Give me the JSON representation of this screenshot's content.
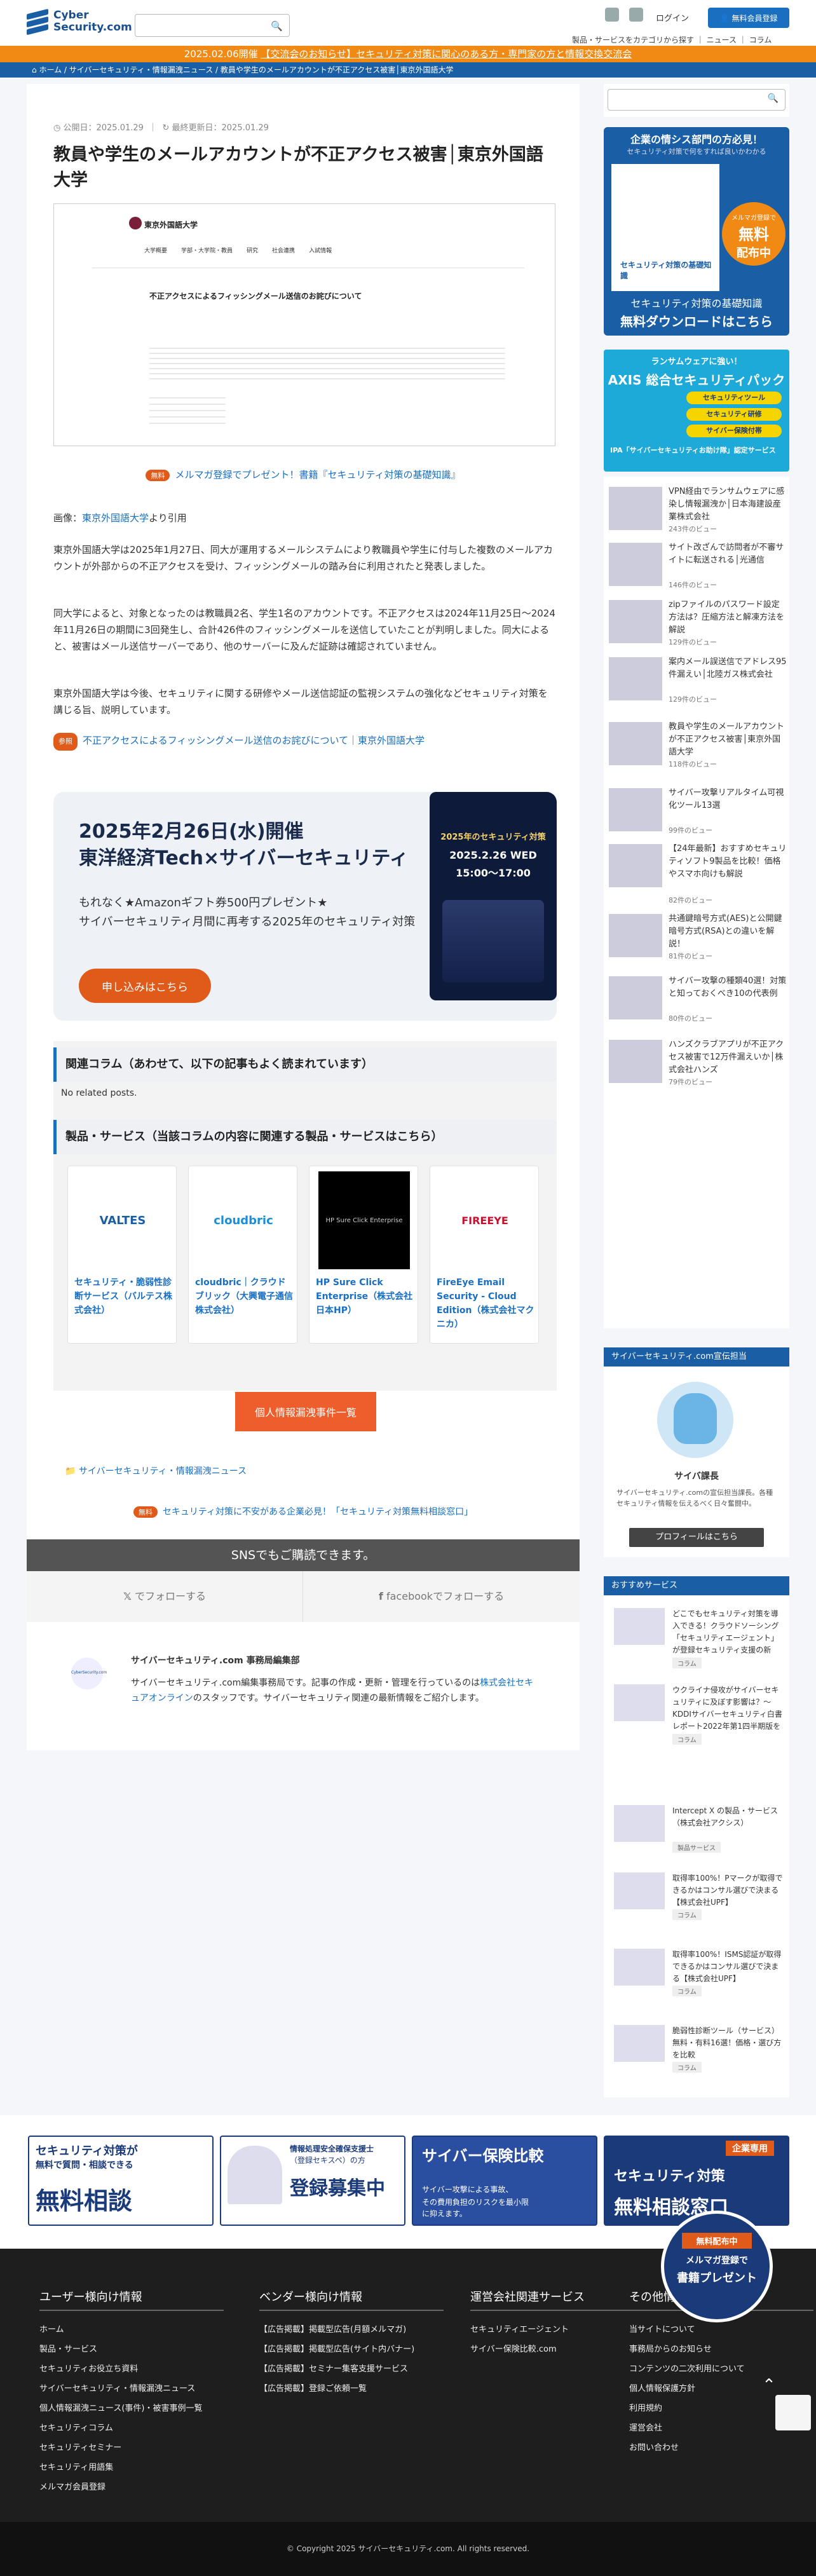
{
  "header": {
    "logo_line1": "Cyber",
    "logo_line2": "Security.com",
    "search_placeholder": "",
    "login": "ログイン",
    "register": "無料会員登録",
    "nav": [
      "製品・サービスをカテゴリから探す",
      "ニュース",
      "コラム"
    ]
  },
  "announcement": {
    "prefix": "2025.02.06開催",
    "link": "【交流会のお知らせ】セキュリティ対策に関心のある方・専門家の方と情報交換交流会"
  },
  "breadcrumb": [
    "ホーム",
    "サイバーセキュリティ・情報漏洩ニュース",
    "教員や学生のメールアカウントが不正アクセス被害│東京外国語大学"
  ],
  "article": {
    "published": "公開日：2025.01.29",
    "updated": "最終更新日：2025.01.29",
    "title": "教員や学生のメールアカウントが不正アクセス被害│東京外国語大学",
    "screenshot": {
      "univ": "東京外国語大学",
      "heading": "不正アクセスによるフィッシングメール送信のお詫びについて",
      "nav": [
        "大学概要",
        "学部・大学院・教員",
        "研究",
        "社会連携",
        "入試情報"
      ]
    },
    "promo_badge": "無料",
    "promo_text": "メルマガ登録でプレゼント！書籍『セキュリティ対策の基礎知識』",
    "img_credit_prefix": "画像：",
    "img_credit_link": "東京外国語大学",
    "img_credit_suffix": "より引用",
    "para1": "東京外国語大学は2025年1月27日、同大が運用するメールシステムにより教職員や学生に付与した複数のメールアカウントが外部からの不正アクセスを受け、フィッシングメールの踏み台に利用されたと発表しました。",
    "para2": "同大学によると、対象となったのは教職員2名、学生1名のアカウントです。不正アクセスは2024年11月25日〜2024年11月26日の期間に3回発生し、合計426件のフィッシングメールを送信していたことが判明しました。同大によると、被害はメール送信サーバーであり、他のサーバーに及んだ証跡は確認されていません。",
    "para3": "東京外国語大学は今後、セキュリティに関する研修やメール送信認証の監視システムの強化などセキュリティ対策を講じる旨、説明しています。",
    "ref_badge": "参照",
    "ref_link": "不正アクセスによるフィッシングメール送信のお詫びについて｜東京外国語大学"
  },
  "event": {
    "title_line1": "2025年2月26日(水)開催",
    "title_line2": "東洋経済Tech×サイバーセキュリティ",
    "sub_line1": "もれなく★Amazonギフト券500円プレゼント★",
    "sub_line2": "サイバーセキュリティ月間に再考する2025年のセキュリティ対策",
    "button": "申し込みはこちら",
    "img_title": "2025年のセキュリティ対策",
    "img_date": "2025.2.26 WED",
    "img_time": "15:00〜17:00"
  },
  "related": {
    "heading": "関連コラム（あわせて、以下の記事もよく読まれています）",
    "empty": "No related posts."
  },
  "products": {
    "heading": "製品・サービス（当該コラムの内容に関連する製品・サービスはこちら）",
    "items": [
      {
        "logo": "VALTES",
        "title": "セキュリティ・脆弱性診断サービス（バルテス株式会社）"
      },
      {
        "logo": "cloudbric",
        "title": "cloudbric｜クラウドブリック（大興電子通信株式会社）"
      },
      {
        "logo": "HP Sure Click Enterprise",
        "title": "HP Sure Click Enterprise（株式会社 日本HP）"
      },
      {
        "logo": "FIREEYE",
        "title": "FireEye Email Security - Cloud Edition（株式会社マクニカ）"
      }
    ]
  },
  "incident_button": "個人情報漏洩事件一覧",
  "category_link": "サイバーセキュリティ・情報漏洩ニュース",
  "consult": {
    "badge": "無料",
    "text": "セキュリティ対策に不安がある企業必見！「セキュリティ対策無料相談窓口」"
  },
  "sns": {
    "heading": "SNSでもご購読できます。",
    "x": "でフォローする",
    "facebook": "facebookでフォローする"
  },
  "author": {
    "name": "サイバーセキュリティ.com 事務局編集部",
    "logo": "CyberSecurity.com",
    "bio_prefix": "サイバーセキュリティ.com編集事務局です。記事の作成・更新・管理を行っているのは",
    "bio_link": "株式会社セキュアオンライン",
    "bio_suffix": "のスタッフです。サイバーセキュリティ関連の最新情報をご紹介します。"
  },
  "sidebar": {
    "ad1": {
      "title": "企業の情シス部門の方必見！",
      "sub": "セキュリティ対策で何をすれば良いかわかる",
      "bubble": [
        "メルマガ登録で",
        "無料",
        "配布中"
      ],
      "book": "セキュリティ対策の基礎知識",
      "cta": "無料ダウンロードはこちら"
    },
    "ad2": {
      "top": "ランサムウェアに強い！",
      "title": "AXIS 総合セキュリティパック",
      "tags": [
        "セキュリティツール",
        "セキュリティ研修",
        "サイバー保険付帯"
      ]
    },
    "ad3": "IPA「サイバーセキュリティお助け隊」認定サービス",
    "ranking": [
      {
        "title": "VPN経由でランサムウェアに感染し情報漏洩か│日本海建設産業株式会社",
        "views": "243件のビュー"
      },
      {
        "title": "サイト改ざんで訪問者が不審サイトに転送される│光通信",
        "views": "146件のビュー"
      },
      {
        "title": "zipファイルのパスワード設定方法は？圧縮方法と解凍方法を解説",
        "views": "129件のビュー"
      },
      {
        "title": "案内メール誤送信でアドレス95件漏えい│北陸ガス株式会社",
        "views": "129件のビュー"
      },
      {
        "title": "教員や学生のメールアカウントが不正アクセス被害│東京外国語大学",
        "views": "118件のビュー"
      },
      {
        "title": "サイバー攻撃リアルタイム可視化ツール13選",
        "views": "99件のビュー"
      },
      {
        "title": "【24年最新】おすすめセキュリティソフト9製品を比較！価格やスマホ向けも解説",
        "views": "82件のビュー"
      },
      {
        "title": "共通鍵暗号方式(AES)と公開鍵暗号方式(RSA)との違いを解説！",
        "views": "81件のビュー"
      },
      {
        "title": "サイバー攻撃の種類40選！対策と知っておくべき10の代表例",
        "views": "80件のビュー"
      },
      {
        "title": "ハンズクラブアプリが不正アクセス被害で12万件漏えいか│株式会社ハンズ",
        "views": "79件のビュー"
      }
    ],
    "owner_heading": "サイバーセキュリティ.com宣伝担当",
    "owner_name": "サイバ課長",
    "owner_desc": "サイバーセキュリティ.comの宣伝担当課長。各種セキュリティ情報を伝えるべく日々奮闘中。",
    "owner_btn": "プロフィールはこちら",
    "rec_heading": "おすすめサービス",
    "rec": [
      {
        "title": "どこでもセキュリティ対策を導入できる！クラウドソーシング「セキュリティエージェント」が登録セキュリティ支援の新",
        "tag": "コラム"
      },
      {
        "title": "ウクライナ侵攻がサイバーセキュリティに及ぼす影響は？〜KDDIサイバーセキュリティ白書レポート2022年第1四半期版を公開〜",
        "tag": "コラム"
      },
      {
        "title": "Intercept X の製品・サービス（株式会社アクシス）",
        "tag": "製品サービス"
      },
      {
        "title": "取得率100%！Pマークが取得できるかはコンサル選びで決まる【株式会社UPF】",
        "tag": "コラム"
      },
      {
        "title": "取得率100%！ISMS認証が取得できるかはコンサル選びで決まる【株式会社UPF】",
        "tag": "コラム"
      },
      {
        "title": "脆弱性診断ツール（サービス）無料・有料16選！価格・選び方を比較",
        "tag": "コラム"
      }
    ]
  },
  "banners": [
    {
      "line1": "セキュリティ対策が",
      "line2": "無料で質問・相談できる",
      "line3": "無料相談"
    },
    {
      "line1": "情報処理安全確保支援士",
      "line2": "（登録セキスペ）の方",
      "line3": "登録募集中"
    },
    {
      "line1": "サイバー保険比較",
      "line2": "サイバー攻撃による事故、",
      "line3": "その費用負担のリスクを最小限に抑えます。"
    },
    {
      "line1": "企業専用",
      "line2": "セキュリティ対策",
      "line3": "無料相談窓口"
    }
  ],
  "float_badge": {
    "top": "無料配布中",
    "line1": "メルマガ登録で",
    "line2": "書籍プレゼント"
  },
  "footer": {
    "cols": [
      {
        "title": "ユーザー様向け情報",
        "items": [
          "ホーム",
          "製品・サービス",
          "セキュリティお役立ち資料",
          "サイバーセキュリティ・情報漏洩ニュース",
          "個人情報漏洩ニュース(事件)・被害事例一覧",
          "セキュリティコラム",
          "セキュリティセミナー",
          "セキュリティ用語集",
          "メルマガ会員登録"
        ]
      },
      {
        "title": "ベンダー様向け情報",
        "items": [
          "【広告掲載】掲載型広告(月額メルマガ)",
          "【広告掲載】掲載型広告(サイト内バナー)",
          "【広告掲載】セミナー集客支援サービス",
          "【広告掲載】登録ご依頼一覧"
        ]
      },
      {
        "title": "運営会社関連サービス",
        "items": [
          "セキュリティエージェント",
          "サイバー保険比較.com"
        ]
      },
      {
        "title": "その他情報",
        "items": [
          "当サイトについて",
          "事務局からのお知らせ",
          "コンテンツの二次利用について",
          "個人情報保護方針",
          "利用規約",
          "運営会社",
          "お問い合わせ"
        ]
      }
    ],
    "copyright": "© Copyright 2025 サイバーセキュリティ.com. All rights reserved."
  }
}
